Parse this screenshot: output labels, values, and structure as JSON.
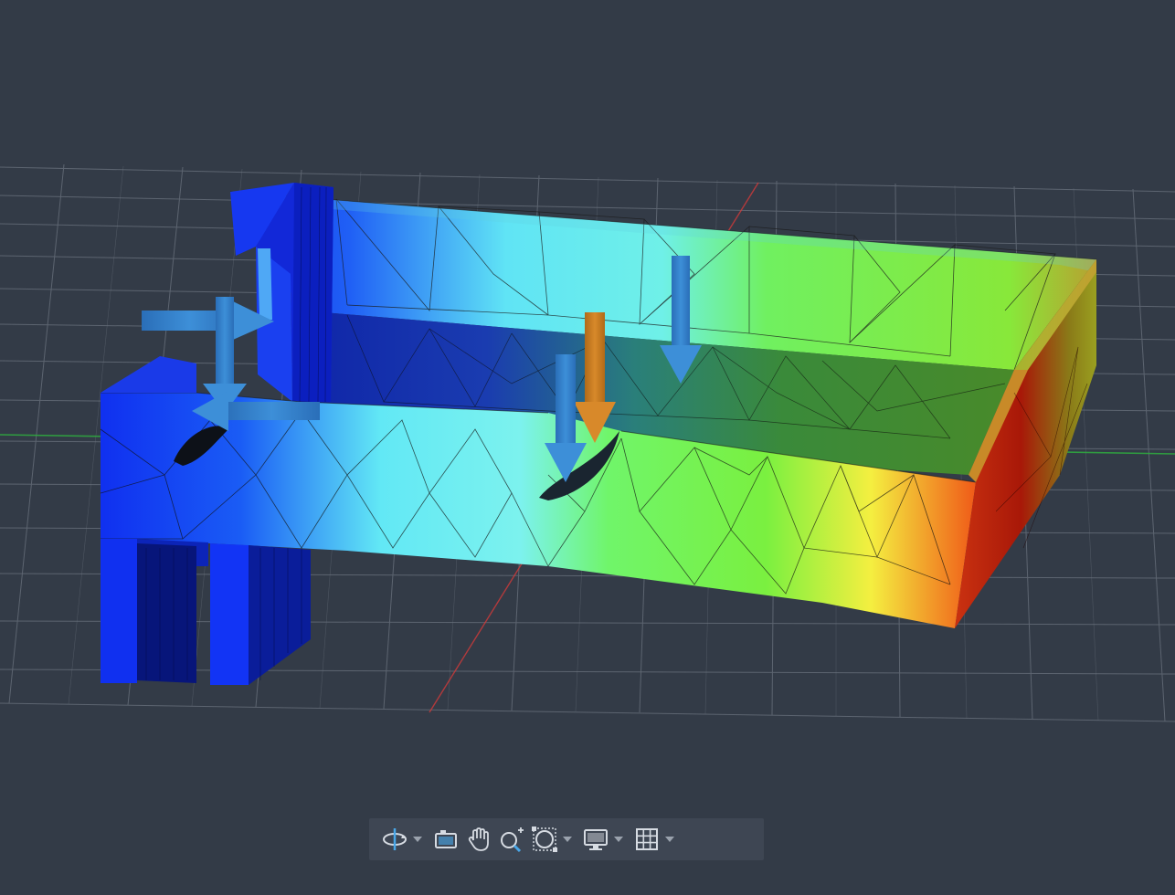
{
  "viewport": {
    "background": "#333b47",
    "grid_color": "#8a919c",
    "x_axis_color": "#d23a3a",
    "y_axis_color": "#2fae3f",
    "mesh_edge_color": "#1a1a1a",
    "load_arrow_colors": [
      "#2f78c4",
      "#c47a1e"
    ]
  },
  "toolbar": {
    "background": "#3e4653",
    "icon_color": "#d6dbe2",
    "accent_color": "#49a7e8",
    "tools": [
      {
        "name": "orbit-icon",
        "has_dropdown": true
      },
      {
        "name": "look-at-icon",
        "has_dropdown": false
      },
      {
        "name": "pan-hand-icon",
        "has_dropdown": false
      },
      {
        "name": "zoom-icon",
        "has_dropdown": false
      },
      {
        "name": "fit-window-icon",
        "has_dropdown": true
      },
      {
        "name": "display-settings-icon",
        "has_dropdown": true
      },
      {
        "name": "grid-icon",
        "has_dropdown": true
      }
    ]
  }
}
